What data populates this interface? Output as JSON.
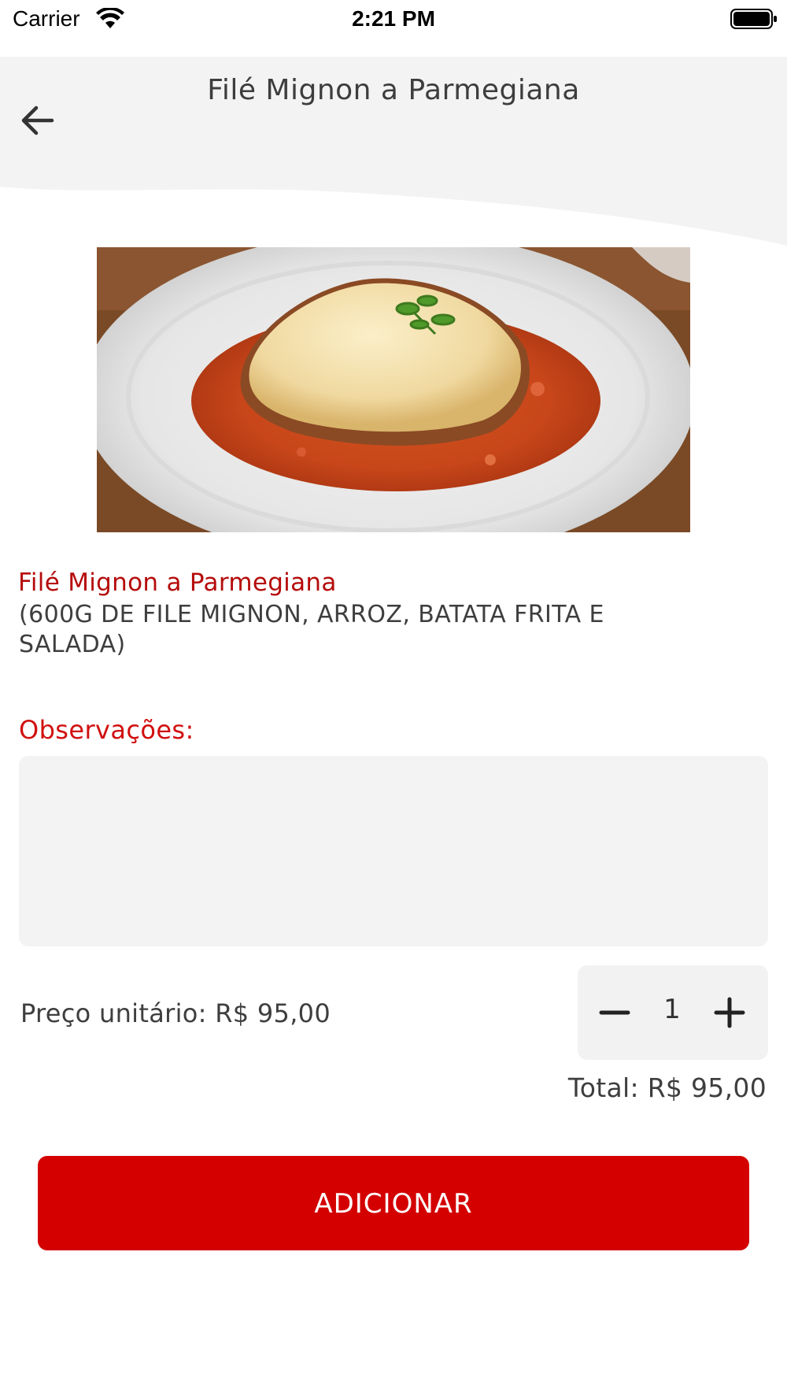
{
  "status_bar": {
    "carrier": "Carrier",
    "time": "2:21 PM"
  },
  "header": {
    "title": "Filé Mignon a Parmegiana",
    "back_icon": "arrow-left-icon"
  },
  "product": {
    "name": "Filé Mignon a Parmegiana",
    "description": "(600G DE FILE MIGNON, ARROZ, BATATA FRITA E SALADA)"
  },
  "observations": {
    "label": "Observações:",
    "value": "",
    "placeholder": ""
  },
  "pricing": {
    "unit_price": "Preço unitário: R$ 95,00",
    "quantity": "1",
    "total": "Total: R$ 95,00"
  },
  "actions": {
    "add_label": "ADICIONAR"
  },
  "colors": {
    "accent": "#d40000",
    "product_name": "#b50b0b",
    "observation_label": "#d11010",
    "header_bg": "#f3f3f3"
  }
}
